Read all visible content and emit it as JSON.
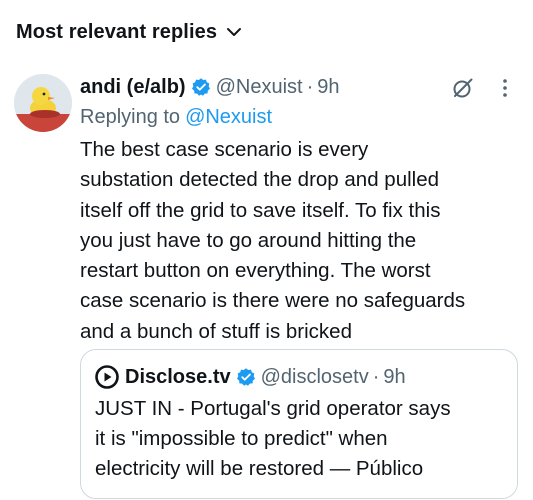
{
  "sort": {
    "label": "Most relevant replies",
    "icon": "chevron-down-icon"
  },
  "reply": {
    "display_name": "andi (e/alb)",
    "handle": "@Nexuist",
    "separator": "·",
    "time": "9h",
    "replying_prefix": "Replying to",
    "replying_handle": "@Nexuist",
    "body_lines": [
      "The best case scenario is every",
      "substation detected the drop and pulled",
      "itself off the grid to save itself. To fix this",
      "you just have to go around hitting the",
      "restart button on everything. The worst",
      "case scenario is there were no safeguards",
      "and a bunch of stuff is bricked"
    ]
  },
  "quote": {
    "display_name": "Disclose.tv",
    "handle": "@disclosetv",
    "separator": "·",
    "time": "9h",
    "body_lines": [
      "JUST IN - Portugal's grid operator says",
      "it is \"impossible to predict\" when",
      "electricity will be restored — Público"
    ]
  },
  "colors": {
    "text": "#0f1419",
    "secondary": "#536471",
    "link": "#1d9bf0",
    "verified": "#1d9bf0",
    "border": "#cfd9de"
  }
}
